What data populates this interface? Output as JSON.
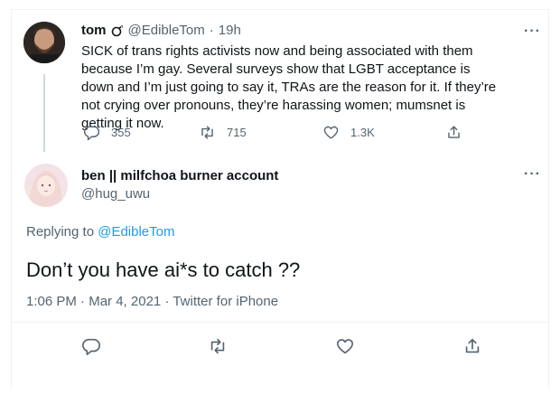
{
  "parent_tweet": {
    "display_name": "tom",
    "badge_icon": "bomb-icon",
    "handle": "@EdibleTom",
    "time": "19h",
    "text": "SICK of trans rights activists now and being associated with them because I’m gay. Several surveys show that LGBT acceptance is down and I’m just going to say it, TRAs are the reason for it. If they’re not crying over pronouns, they’re harassing women; mumsnet is getting it now.",
    "replies": "355",
    "retweets": "715",
    "likes": "1.3K"
  },
  "reply_tweet": {
    "display_name": "ben || milfchoa burner account",
    "handle": "@hug_uwu",
    "replying_prefix": "Replying to",
    "replying_to": "@EdibleTom",
    "text": "Don’t you have ai*s to catch ??",
    "time": "1:06 PM",
    "date": "Mar 4, 2021",
    "source": "Twitter for iPhone"
  },
  "separator": "·",
  "colors": {
    "link": "#1d9bf0",
    "muted": "#536471",
    "text": "#0f1419",
    "border": "#eff3f4"
  }
}
